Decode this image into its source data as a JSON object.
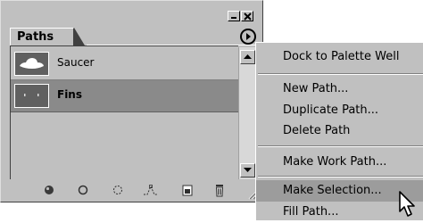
{
  "window": {
    "tab_label": "Paths",
    "minimize_icon": "minimize-icon",
    "close_icon": "close-icon",
    "palette_menu_icon": "palette-menu-arrow-icon"
  },
  "paths": [
    {
      "name": "Saucer",
      "selected": false,
      "thumbnail": "saucer-shape-thumbnail"
    },
    {
      "name": "Fins",
      "selected": true,
      "thumbnail": "fins-dots-thumbnail"
    }
  ],
  "toolbar": {
    "icons": [
      "fill-path-icon",
      "stroke-path-icon",
      "load-path-as-selection-icon",
      "make-work-path-icon",
      "new-path-icon",
      "delete-path-icon"
    ]
  },
  "menu": {
    "items": [
      {
        "label": "Dock to Palette Well",
        "highlighted": false
      },
      {
        "label": "New Path...",
        "highlighted": false
      },
      {
        "label": "Duplicate Path...",
        "highlighted": false
      },
      {
        "label": "Delete Path",
        "highlighted": false
      },
      {
        "label": "Make Work Path...",
        "highlighted": false
      },
      {
        "label": "Make Selection...",
        "highlighted": true
      },
      {
        "label": "Fill Path...",
        "highlighted": false
      }
    ]
  },
  "colors": {
    "panel": "#c0c0c0",
    "selected_row": "#8a8a8a",
    "menu_highlight": "#9c9c9c"
  }
}
